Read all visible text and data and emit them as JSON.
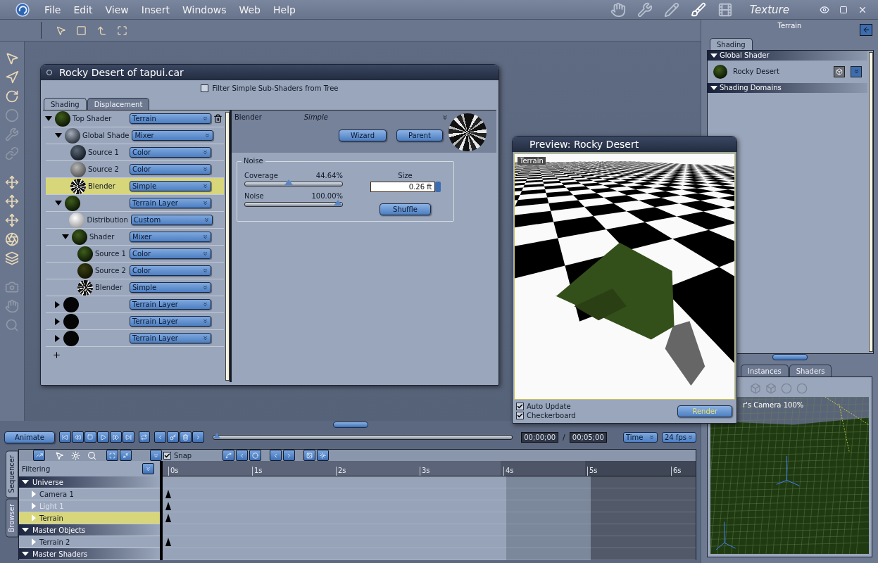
{
  "menu_bar": {
    "items": [
      "File",
      "Edit",
      "View",
      "Insert",
      "Windows",
      "Web",
      "Help"
    ],
    "room": "Texture"
  },
  "shader_window": {
    "title": "Rocky Desert of tapui.car",
    "filter": {
      "label": "Filter Simple Sub-Shaders from Tree",
      "checked": false
    },
    "tabs": [
      {
        "label": "Shading",
        "selected": true
      },
      {
        "label": "Displacement",
        "selected": false
      }
    ],
    "tree": [
      {
        "name": "Top Shader",
        "type": "Terrain",
        "kind": "green",
        "expanded": true,
        "selected": false,
        "delete_icon": true,
        "children": [
          {
            "name": "Global Shade",
            "type": "Mixer",
            "kind": "rock",
            "expanded": true,
            "selected": false,
            "children": [
              {
                "name": "Source 1",
                "type": "Color",
                "kind": "slate",
                "selected": false
              },
              {
                "name": "Source 2",
                "type": "Color",
                "kind": "grey",
                "selected": false
              },
              {
                "name": "Blender",
                "type": "Simple",
                "kind": "noise",
                "selected": true
              }
            ]
          },
          {
            "type": "Terrain Layer",
            "kind": "green",
            "expanded": true,
            "selected": false,
            "children": [
              {
                "name": "Distribution",
                "type": "Custom",
                "kind": "white",
                "selected": false
              },
              {
                "name": "Shader",
                "type": "Mixer",
                "kind": "green",
                "expanded": true,
                "selected": false,
                "children": [
                  {
                    "name": "Source 1",
                    "type": "Color",
                    "kind": "green",
                    "selected": false
                  },
                  {
                    "name": "Source 2",
                    "type": "Color",
                    "kind": "olive",
                    "selected": false
                  },
                  {
                    "name": "Blender",
                    "type": "Simple",
                    "kind": "noise",
                    "selected": false
                  }
                ]
              }
            ]
          },
          {
            "type": "Terrain Layer",
            "kind": "black",
            "expanded": false,
            "selected": false
          },
          {
            "type": "Terrain Layer",
            "kind": "black",
            "expanded": false,
            "selected": false
          },
          {
            "type": "Terrain Layer",
            "kind": "black",
            "expanded": false,
            "selected": false
          }
        ]
      }
    ],
    "editor": {
      "shader": "Blender",
      "mode": "Simple",
      "buttons": [
        "Wizard",
        "Parent"
      ],
      "group": "Noise",
      "sliders": [
        {
          "label": "Coverage",
          "reading": "44.64%",
          "level": 0.4464
        },
        {
          "label": "Noise",
          "reading": "100.00%",
          "level": 1
        }
      ],
      "size": {
        "label": "Size",
        "value": "0.26 ft"
      },
      "shuffle": "Shuffle"
    }
  },
  "preview": {
    "title": "Preview: Rocky Desert",
    "overlay": "Terrain",
    "options": [
      {
        "label": "Auto Update",
        "checked": true
      },
      {
        "label": "Checkerboard",
        "checked": true
      }
    ],
    "render": "Render"
  },
  "right_panel": {
    "title": "Terrain",
    "tabs": [
      {
        "label": "Shading",
        "selected": true
      }
    ],
    "sections": [
      {
        "title": "Global Shader",
        "expanded": true,
        "items": [
          {
            "name": "Rocky Desert",
            "kind": "green"
          }
        ]
      },
      {
        "title": "Shading Domains",
        "expanded": true
      }
    ],
    "bottom_tabs": [
      {
        "label": "Instances",
        "selected": false
      },
      {
        "label": "Shaders",
        "selected": false
      }
    ],
    "view_label": "r's Camera 100%"
  },
  "animation_bar": {
    "animate": "Animate",
    "scrubber": {
      "level": 0
    },
    "current_time": "00;00;00",
    "separator": "/",
    "end_time": "00;05;00",
    "time_mode": "Time",
    "fps": "24 fps"
  },
  "sequencer": {
    "side_tabs": [
      {
        "label": "Sequencer",
        "selected": true
      },
      {
        "label": "Browser",
        "selected": false
      }
    ],
    "snap": {
      "label": "Snap",
      "checked": true
    },
    "filtering": "Filtering",
    "ruler": [
      "0s",
      "1s",
      "2s",
      "3s",
      "4s",
      "5s",
      "6s"
    ],
    "tracks": [
      {
        "label": "Universe",
        "kind": "group",
        "selected": false,
        "keyframe": false
      },
      {
        "label": "Camera 1",
        "kind": "item",
        "selected": false,
        "disabled": false,
        "keyframe": true
      },
      {
        "label": "Light 1",
        "kind": "item",
        "selected": false,
        "disabled": true,
        "keyframe": true
      },
      {
        "label": "Terrain",
        "kind": "item",
        "selected": true,
        "disabled": false,
        "keyframe": true
      },
      {
        "label": "Master Objects",
        "kind": "group",
        "selected": false,
        "keyframe": false
      },
      {
        "label": "Terrain 2",
        "kind": "item",
        "selected": false,
        "disabled": false,
        "keyframe": true
      },
      {
        "label": "Master Shaders",
        "kind": "group",
        "selected": false,
        "keyframe": false
      }
    ]
  }
}
